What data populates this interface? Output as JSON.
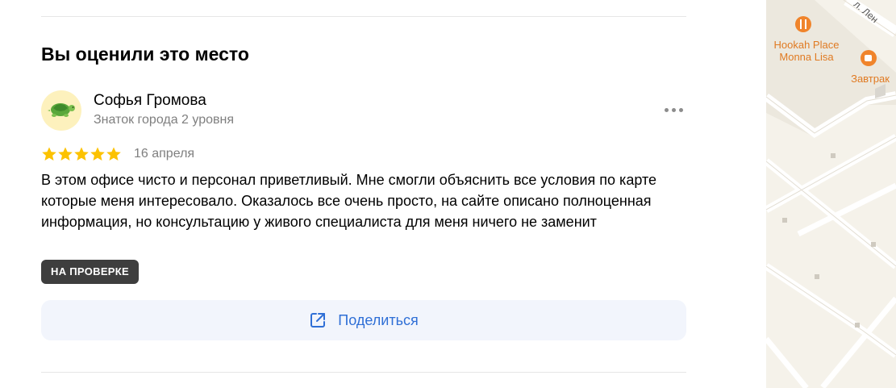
{
  "section": {
    "title": "Вы оценили это место"
  },
  "review": {
    "author_name": "Софья Громова",
    "author_level": "Знаток города 2 уровня",
    "rating": 5,
    "date": "16 апреля",
    "text": "В этом офисе чисто и персонал приветливый. Мне смогли объяснить все условия по карте которые меня интересовало. Оказалось все очень просто, на сайте описано полноценная информация, но консультацию у живого специалиста для меня ничего не заменит",
    "status_badge": "НА ПРОВЕРКЕ",
    "share_label": "Поделиться"
  },
  "map": {
    "street_label": "л. Лен",
    "pois": [
      {
        "name": "Hookah Place Monna Lisa",
        "icon": "fork-knife-icon"
      },
      {
        "name": "Завтрак",
        "icon": "coffee-cup-icon"
      }
    ]
  },
  "colors": {
    "star": "#fcc200",
    "link": "#2f6fd6",
    "badge_bg": "#3e3e3e",
    "share_bg": "#f2f5fc",
    "poi": "#e07a22"
  }
}
